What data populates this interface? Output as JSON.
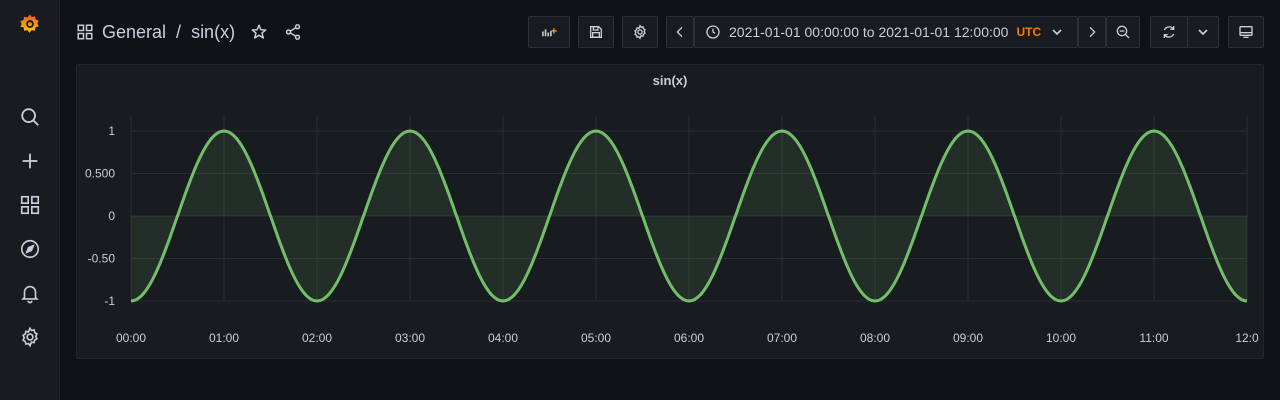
{
  "breadcrumb": {
    "folder": "General",
    "separator": "/",
    "dashboard": "sin(x)"
  },
  "time_range": {
    "label": "2021-01-01 00:00:00 to 2021-01-01 12:00:00",
    "timezone": "UTC"
  },
  "panel": {
    "title": "sin(x)"
  },
  "colors": {
    "series": "#73bf69",
    "accent": "#ff780a",
    "background": "#111217",
    "panel": "#181b1f"
  },
  "icons": {
    "sidebar": [
      "grafana-logo-icon",
      "search-icon",
      "plus-icon",
      "dashboards-icon",
      "explore-icon",
      "alert-bell-icon",
      "gear-icon"
    ],
    "header": [
      "dashboard-grid-icon",
      "star-icon",
      "share-icon",
      "add-panel-icon",
      "save-icon",
      "settings-icon",
      "chevron-left-icon",
      "clock-icon",
      "chevron-down-icon",
      "chevron-right-icon",
      "zoom-out-icon",
      "refresh-icon",
      "chevron-down-icon",
      "tv-icon"
    ]
  },
  "chart_data": {
    "type": "line",
    "title": "sin(x)",
    "x_ticks": [
      "00:00",
      "01:00",
      "02:00",
      "03:00",
      "04:00",
      "05:00",
      "06:00",
      "07:00",
      "08:00",
      "09:00",
      "10:00",
      "11:00",
      "12:0"
    ],
    "y_ticks": [
      "1",
      "0.500",
      "0",
      "-0.50",
      "-1"
    ],
    "y_tick_values": [
      1,
      0.5,
      0,
      -0.5,
      -1
    ],
    "xlim": [
      "00:00",
      "12:00"
    ],
    "ylim": [
      -1,
      1
    ],
    "series": [
      {
        "color": "#73bf69",
        "fill": "area-to-zero",
        "period_hours": 2,
        "amplitude": 1,
        "points": [
          {
            "x": "00:00",
            "y": -1
          },
          {
            "x": "00:30",
            "y": 0
          },
          {
            "x": "01:00",
            "y": 1
          },
          {
            "x": "01:30",
            "y": 0
          },
          {
            "x": "02:00",
            "y": -1
          },
          {
            "x": "02:30",
            "y": 0
          },
          {
            "x": "03:00",
            "y": 1
          },
          {
            "x": "03:30",
            "y": 0
          },
          {
            "x": "04:00",
            "y": -1
          },
          {
            "x": "04:30",
            "y": 0
          },
          {
            "x": "05:00",
            "y": 1
          },
          {
            "x": "05:30",
            "y": 0
          },
          {
            "x": "06:00",
            "y": -1
          },
          {
            "x": "06:30",
            "y": 0
          },
          {
            "x": "07:00",
            "y": 1
          },
          {
            "x": "07:30",
            "y": 0
          },
          {
            "x": "08:00",
            "y": -1
          },
          {
            "x": "08:30",
            "y": 0
          },
          {
            "x": "09:00",
            "y": 1
          },
          {
            "x": "09:30",
            "y": 0
          },
          {
            "x": "10:00",
            "y": -1
          },
          {
            "x": "10:30",
            "y": 0
          },
          {
            "x": "11:00",
            "y": 1
          },
          {
            "x": "11:30",
            "y": 0
          },
          {
            "x": "12:00",
            "y": -1
          }
        ]
      }
    ],
    "grid": true,
    "legend": "none"
  }
}
